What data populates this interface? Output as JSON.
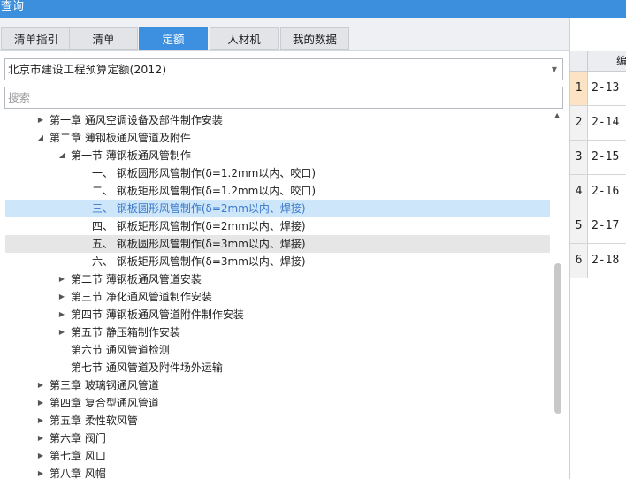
{
  "window": {
    "title": "查询"
  },
  "tabs": [
    {
      "label": "清单指引",
      "active": false
    },
    {
      "label": "清单",
      "active": false
    },
    {
      "label": "定额",
      "active": true
    },
    {
      "label": "人材机",
      "active": false
    },
    {
      "label": "我的数据",
      "active": false
    }
  ],
  "library": {
    "selected": "北京市建设工程预算定额(2012)"
  },
  "search": {
    "placeholder": "搜索"
  },
  "tree": [
    {
      "label": "第一章 通风空调设备及部件制作安装",
      "level": 0,
      "twisty": "▶",
      "state": ""
    },
    {
      "label": "第二章 薄钢板通风管道及附件",
      "level": 0,
      "twisty": "◢",
      "state": ""
    },
    {
      "label": "第一节 薄钢板通风管制作",
      "level": 1,
      "twisty": "◢",
      "state": ""
    },
    {
      "label": "一、 钢板圆形风管制作(δ=1.2mm以内、咬口)",
      "level": 2,
      "twisty": "",
      "state": ""
    },
    {
      "label": "二、 钢板矩形风管制作(δ=1.2mm以内、咬口)",
      "level": 2,
      "twisty": "",
      "state": ""
    },
    {
      "label": "三、 钢板圆形风管制作(δ=2mm以内、焊接)",
      "level": 2,
      "twisty": "",
      "state": "selected"
    },
    {
      "label": "四、 钢板矩形风管制作(δ=2mm以内、焊接)",
      "level": 2,
      "twisty": "",
      "state": ""
    },
    {
      "label": "五、 钢板圆形风管制作(δ=3mm以内、焊接)",
      "level": 2,
      "twisty": "",
      "state": "hover"
    },
    {
      "label": "六、 钢板矩形风管制作(δ=3mm以内、焊接)",
      "level": 2,
      "twisty": "",
      "state": ""
    },
    {
      "label": "第二节 薄钢板通风管道安装",
      "level": 1,
      "twisty": "▶",
      "state": ""
    },
    {
      "label": "第三节 净化通风管道制作安装",
      "level": 1,
      "twisty": "▶",
      "state": ""
    },
    {
      "label": "第四节 薄钢板通风管道附件制作安装",
      "level": 1,
      "twisty": "▶",
      "state": ""
    },
    {
      "label": "第五节 静压箱制作安装",
      "level": 1,
      "twisty": "▶",
      "state": ""
    },
    {
      "label": "第六节 通风管道检测",
      "level": 1,
      "twisty": "",
      "state": ""
    },
    {
      "label": "第七节 通风管道及附件场外运输",
      "level": 1,
      "twisty": "",
      "state": ""
    },
    {
      "label": "第三章 玻璃钢通风管道",
      "level": 0,
      "twisty": "▶",
      "state": ""
    },
    {
      "label": "第四章 复合型通风管道",
      "level": 0,
      "twisty": "▶",
      "state": ""
    },
    {
      "label": "第五章 柔性软风管",
      "level": 0,
      "twisty": "▶",
      "state": ""
    },
    {
      "label": "第六章 阀门",
      "level": 0,
      "twisty": "▶",
      "state": ""
    },
    {
      "label": "第七章 风口",
      "level": 0,
      "twisty": "▶",
      "state": ""
    },
    {
      "label": "第八章 风帽",
      "level": 0,
      "twisty": "▶",
      "state": ""
    }
  ],
  "results": {
    "column": "编",
    "rows": [
      {
        "num": "1",
        "code": "2-13"
      },
      {
        "num": "2",
        "code": "2-14"
      },
      {
        "num": "3",
        "code": "2-15"
      },
      {
        "num": "4",
        "code": "2-16"
      },
      {
        "num": "5",
        "code": "2-17"
      },
      {
        "num": "6",
        "code": "2-18"
      }
    ]
  },
  "colors": {
    "titlebar": "#3c8fdc",
    "tab_active": "#3d8fe0",
    "selected_row": "#cde6fa",
    "selected_text": "#3a78c9"
  }
}
